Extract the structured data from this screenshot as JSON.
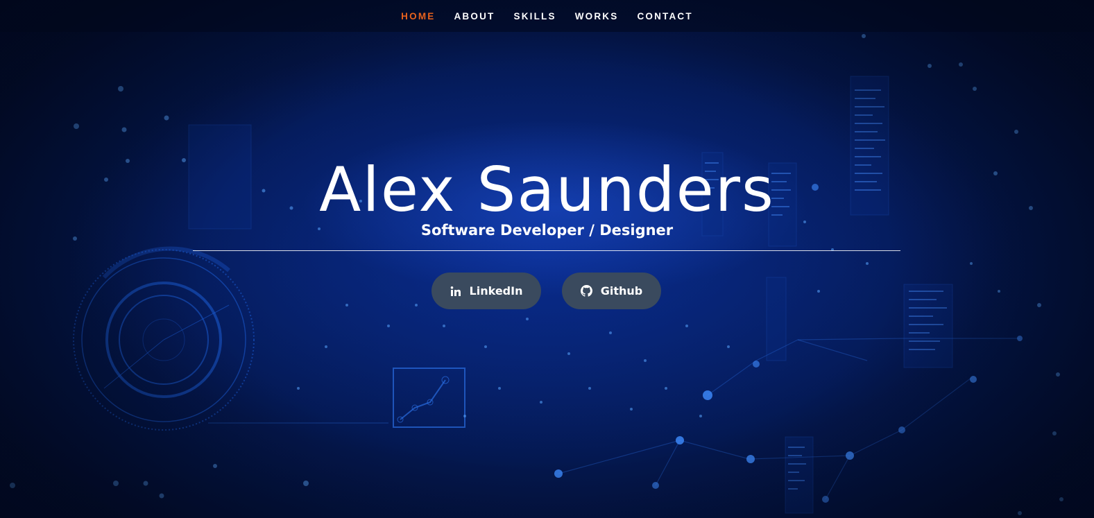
{
  "nav": {
    "items": [
      {
        "label": "HOME",
        "active": true
      },
      {
        "label": "ABOUT",
        "active": false
      },
      {
        "label": "SKILLS",
        "active": false
      },
      {
        "label": "WORKS",
        "active": false
      },
      {
        "label": "CONTACT",
        "active": false
      }
    ],
    "active_color": "#e8621d"
  },
  "hero": {
    "name": "Alex Saunders",
    "tagline": "Software Developer / Designer"
  },
  "social": {
    "linkedin": {
      "label": "LinkedIn",
      "icon": "linkedin-icon"
    },
    "github": {
      "label": "Github",
      "icon": "github-icon"
    }
  },
  "colors": {
    "background": "#041850",
    "button": "#3a4a5e"
  }
}
